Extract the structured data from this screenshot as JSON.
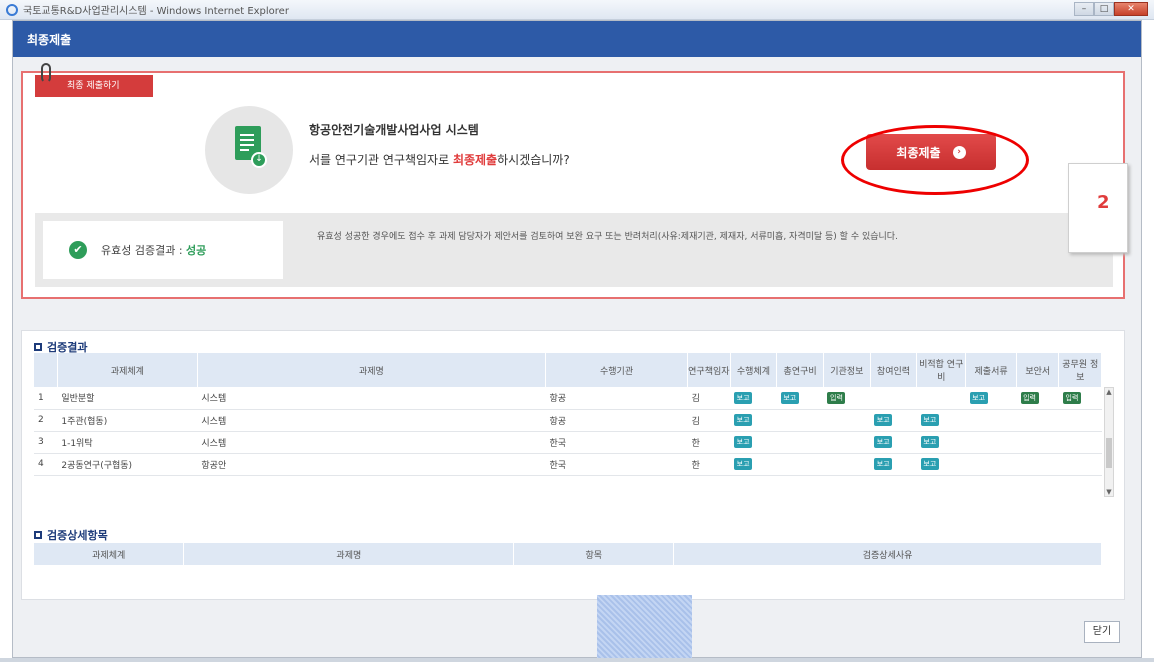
{
  "window": {
    "title": "국토교통R&D사업관리시스템 - Windows Internet Explorer",
    "minimize": "–",
    "maximize": "□",
    "close": "✕"
  },
  "popup": {
    "header": "최종제출"
  },
  "submit": {
    "tag_label": "최종 제출하기",
    "line1": "항공안전기술개발사업사업 시스템",
    "line2_pre": "서를 연구기관 연구책임자로 ",
    "line2_hl": "최종제출",
    "line2_post": "하시겠습니까?",
    "button_label": "최종제출",
    "button_arrow": "›"
  },
  "validation": {
    "label": "유효성 검증결과 : ",
    "result": "성공",
    "note": "유효성 성공한 경우에도 접수 후 과제 담당자가 제안서를 검토하여 보완 요구 또는 반려처리(사유:제재기관, 제재자, 서류미흡, 자격미달 등) 할 수 있습니다."
  },
  "annotation": {
    "step_number": "2"
  },
  "results": {
    "title": "검증결과",
    "columns": [
      "과제체계",
      "과제명",
      "수행기관",
      "연구책임자",
      "수행체계",
      "총연구비",
      "기관정보",
      "참여인력",
      "비적합 연구비",
      "제출서류",
      "보안서",
      "공무원 정보"
    ],
    "rows": [
      {
        "no": "1",
        "system": "일반분할",
        "name": "시스템",
        "org": "항공",
        "lead": "김",
        "buttons": [
          "보고",
          "보고",
          "입력",
          "",
          "",
          "보고",
          "입력",
          "입력"
        ]
      },
      {
        "no": "2",
        "system": "1주관(협동)",
        "name": "시스템",
        "org": "항공",
        "lead": "김",
        "buttons": [
          "보고",
          "",
          "",
          "보고",
          "보고",
          "",
          "",
          ""
        ]
      },
      {
        "no": "3",
        "system": "1-1위탁",
        "name": "시스템",
        "org": "한국",
        "lead": "한",
        "buttons": [
          "보고",
          "",
          "",
          "보고",
          "보고",
          "",
          "",
          ""
        ]
      },
      {
        "no": "4",
        "system": "2공동연구(구협동)",
        "name": "항공안",
        "org": "한국",
        "lead": "한",
        "buttons": [
          "보고",
          "",
          "",
          "보고",
          "보고",
          "",
          "",
          ""
        ]
      }
    ],
    "scroll_up": "▲",
    "scroll_down": "▼"
  },
  "detail": {
    "title": "검증상세항목",
    "columns": [
      "과제체계",
      "과제명",
      "항목",
      "검증상세사유"
    ]
  },
  "footer": {
    "close_label": "닫기"
  },
  "colors": {
    "header_blue": "#2d5aa7",
    "accent_red": "#d23a3a",
    "success_green": "#2e9d5a",
    "teal_button": "#2a9fb1"
  }
}
